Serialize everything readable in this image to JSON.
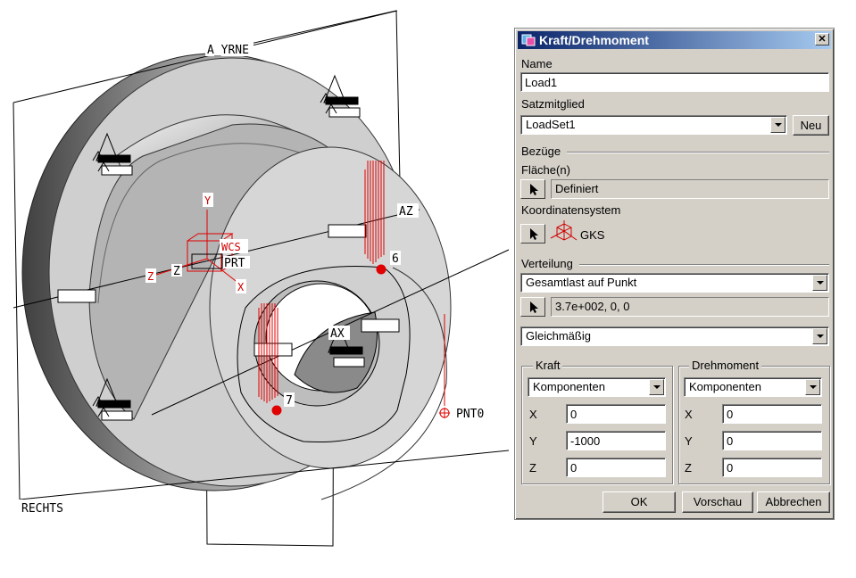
{
  "viewport": {
    "labels": {
      "top_plane": "A̲YRNE",
      "right_plane": "RECHTS",
      "axis_az": "AZ",
      "axis_ax": "AX",
      "wcs": "WCS",
      "prt": "PRT",
      "y_axis": "Y",
      "z_axis": "Z",
      "x_axis": "X",
      "point": "PNT0",
      "num_6": "6",
      "num_7": "7"
    },
    "colors": {
      "part": "#c8c8c8",
      "force": "#e00000",
      "lines": "#000000"
    }
  },
  "dialog": {
    "title": "Kraft/Drehmoment",
    "name_label": "Name",
    "name_value": "Load1",
    "satz_label": "Satzmitglied",
    "satz_value": "LoadSet1",
    "neu_label": "Neu",
    "bezuege_label": "Bezüge",
    "flaeche_label": "Fläche(n)",
    "flaeche_value": "Definiert",
    "koord_label": "Koordinatensystem",
    "koord_value": "GKS",
    "verteilung_label": "Verteilung",
    "verteilung_value": "Gesamtlast auf Punkt",
    "point_value": "3.7e+002, 0, 0",
    "gleich_value": "Gleichmäßig",
    "kraft_title": "Kraft",
    "kraft_mode": "Komponenten",
    "kraft_x_label": "X",
    "kraft_x": "0",
    "kraft_y_label": "Y",
    "kraft_y": "-1000",
    "kraft_z_label": "Z",
    "kraft_z": "0",
    "dreh_title": "Drehmoment",
    "dreh_mode": "Komponenten",
    "dreh_x_label": "X",
    "dreh_x": "0",
    "dreh_y_label": "Y",
    "dreh_y": "0",
    "dreh_z_label": "Z",
    "dreh_z": "0",
    "ok_label": "OK",
    "vorschau_label": "Vorschau",
    "abbrechen_label": "Abbrechen",
    "close_glyph": "✕"
  }
}
